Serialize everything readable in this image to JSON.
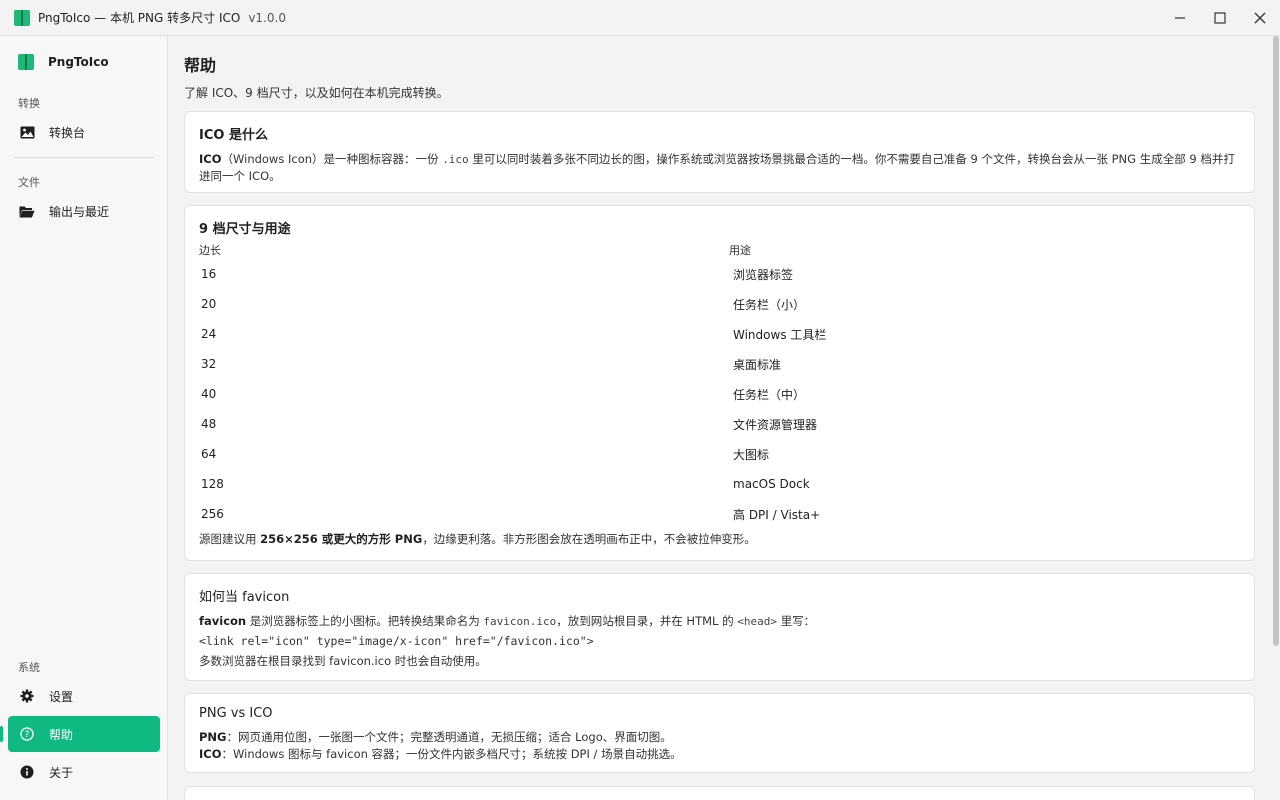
{
  "window": {
    "title": "PngToIco — 本机 PNG 转多尺寸 ICO",
    "version": "v1.0.0",
    "controls": [
      "minimize-icon",
      "maximize-icon",
      "close-icon"
    ]
  },
  "sidebar": {
    "brand": "PngToIco",
    "sections": {
      "convert": "转换",
      "files": "文件",
      "system": "系统"
    },
    "items": {
      "workbench": "转换台",
      "output": "输出与最近",
      "settings": "设置",
      "help": "帮助",
      "about": "关于"
    },
    "active": "help",
    "accent": "#10b981"
  },
  "main": {
    "title": "帮助",
    "subtitle": "了解 ICO、9 档尺寸，以及如何在本机完成转换。",
    "card_ico": {
      "title": "ICO 是什么",
      "body_bold": "ICO",
      "body_1": "（Windows Icon）是一种图标容器：一份 ",
      "body_code": ".ico",
      "body_2": " 里可以同时装着多张不同边长的图，操作系统或浏览器按场景挑最合适的一档。你不需要自己准备 9 个文件，转换台会从一张 PNG 生成全部 9 档并打进同一个 ICO。"
    },
    "card_sizes": {
      "title": "9 档尺寸与用途",
      "headers": [
        "边长",
        "用途"
      ],
      "rows": [
        [
          "16",
          "浏览器标签"
        ],
        [
          "20",
          "任务栏（小）"
        ],
        [
          "24",
          "Windows 工具栏"
        ],
        [
          "32",
          "桌面标准"
        ],
        [
          "40",
          "任务栏（中）"
        ],
        [
          "48",
          "文件资源管理器"
        ],
        [
          "64",
          "大图标"
        ],
        [
          "128",
          "macOS Dock"
        ],
        [
          "256",
          "高 DPI / Vista+"
        ]
      ],
      "note_1": "源图建议用 ",
      "note_bold": "256×256 或更大的方形 PNG",
      "note_2": "，边缘更利落。非方形图会放在透明画布正中，不会被拉伸变形。"
    },
    "card_favicon": {
      "title": "如何当 favicon",
      "line1_bold": "favicon",
      "line1_a": " 是浏览器标签上的小图标。把转换结果命名为 ",
      "line1_code1": "favicon.ico",
      "line1_b": "，放到网站根目录，并在 HTML 的 ",
      "line1_code2": "<head>",
      "line1_c": " 里写：",
      "code": "<link rel=\"icon\" type=\"image/x-icon\" href=\"/favicon.ico\">",
      "line3": "多数浏览器在根目录找到 favicon.ico 时也会自动使用。"
    },
    "card_compare": {
      "title": "PNG vs ICO",
      "png_label": "PNG",
      "png_text": "：网页通用位图，一张图一个文件；完整透明通道，无损压缩；适合 Logo、界面切图。",
      "ico_label": "ICO",
      "ico_text": "：Windows 图标与 favicon 容器；一份文件内嵌多档尺寸；系统按 DPI / 场景自动挑选。"
    }
  }
}
